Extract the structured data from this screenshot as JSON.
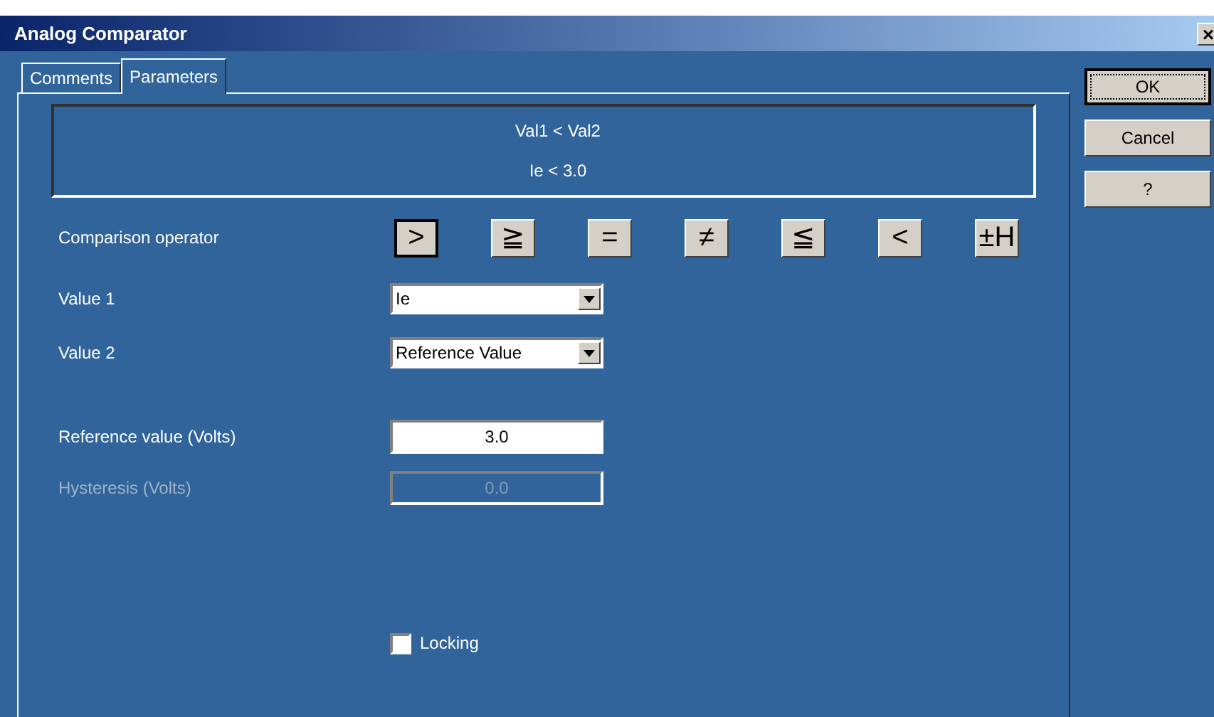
{
  "window": {
    "title": "Analog Comparator",
    "close": "×"
  },
  "tabs": [
    {
      "label": "Comments",
      "selected": false
    },
    {
      "label": "Parameters",
      "selected": true
    }
  ],
  "summary": [
    "Val1 < Val2",
    "Ie < 3.0"
  ],
  "comparison": {
    "label": "Comparison operator",
    "operators": [
      {
        "symbol": ">",
        "selected": true
      },
      {
        "symbol": "≧",
        "selected": false
      },
      {
        "symbol": "=",
        "selected": false
      },
      {
        "symbol": "≠",
        "selected": false
      },
      {
        "symbol": "≦",
        "selected": false
      },
      {
        "symbol": "<",
        "selected": false
      },
      {
        "symbol": "±H",
        "selected": false
      }
    ]
  },
  "selects": [
    {
      "label": "Value 1",
      "value": "Ie"
    },
    {
      "label": "Value 2",
      "value": "Reference Value"
    }
  ],
  "fields": [
    {
      "label": "Reference value (Volts)",
      "value": "3.0",
      "disabled": false
    },
    {
      "label": "Hysteresis (Volts)",
      "value": "0.0",
      "disabled": true
    }
  ],
  "locking": {
    "label": "Locking",
    "checked": false
  },
  "buttons": [
    {
      "label": "OK",
      "default": true
    },
    {
      "label": "Cancel",
      "default": false
    },
    {
      "label": "?",
      "default": false
    }
  ]
}
